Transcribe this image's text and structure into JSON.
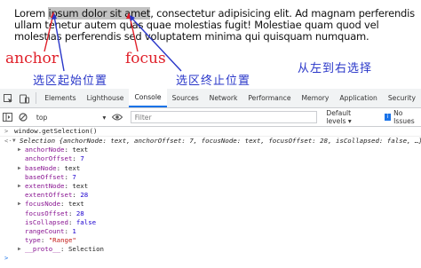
{
  "demo": {
    "text_before": "Lorem ",
    "text_selected": "ipsum dolor sit amet",
    "text_after": ", consectetur adipisicing elit. Ad magnam perferendis ullam tenetur autem quas quae molestias fugit! Molestiae quam quod vel molestias perferendis sed voluptatem minima qui quisquam numquam.",
    "anchor_label": "anchor",
    "focus_label": "focus",
    "anchor_desc": "选区起始位置",
    "focus_desc": "选区终止位置",
    "direction_desc": "从左到右选择",
    "annotation_color": "#e0202a",
    "desc_color": "#2a37c9"
  },
  "devtools": {
    "tabs": [
      "Elements",
      "Lighthouse",
      "Console",
      "Sources",
      "Network",
      "Performance",
      "Memory",
      "Application",
      "Security"
    ],
    "active_tab": "Console",
    "context": "top",
    "filter_placeholder": "Filter",
    "levels": "Default levels ▾",
    "issues": "No Issues",
    "accent": "#1a73e8"
  },
  "console": {
    "command": "window.getSelection()",
    "summary": "Selection {anchorNode: text, anchorOffset: 7, focusNode: text, focusOffset: 28, isCollapsed: false, …}",
    "properties": [
      {
        "key": "anchorNode",
        "value": "text",
        "expandable": true
      },
      {
        "key": "anchorOffset",
        "value": "7",
        "expandable": false,
        "kind": "num"
      },
      {
        "key": "baseNode",
        "value": "text",
        "expandable": true
      },
      {
        "key": "baseOffset",
        "value": "7",
        "expandable": false,
        "kind": "num"
      },
      {
        "key": "extentNode",
        "value": "text",
        "expandable": true
      },
      {
        "key": "extentOffset",
        "value": "28",
        "expandable": false,
        "kind": "num"
      },
      {
        "key": "focusNode",
        "value": "text",
        "expandable": true
      },
      {
        "key": "focusOffset",
        "value": "28",
        "expandable": false,
        "kind": "num"
      },
      {
        "key": "isCollapsed",
        "value": "false",
        "expandable": false,
        "kind": "bool"
      },
      {
        "key": "rangeCount",
        "value": "1",
        "expandable": false,
        "kind": "num"
      },
      {
        "key": "type",
        "value": "\"Range\"",
        "expandable": false,
        "kind": "str"
      },
      {
        "key": "__proto__",
        "value": "Selection",
        "expandable": true,
        "kind": "proto"
      }
    ]
  }
}
